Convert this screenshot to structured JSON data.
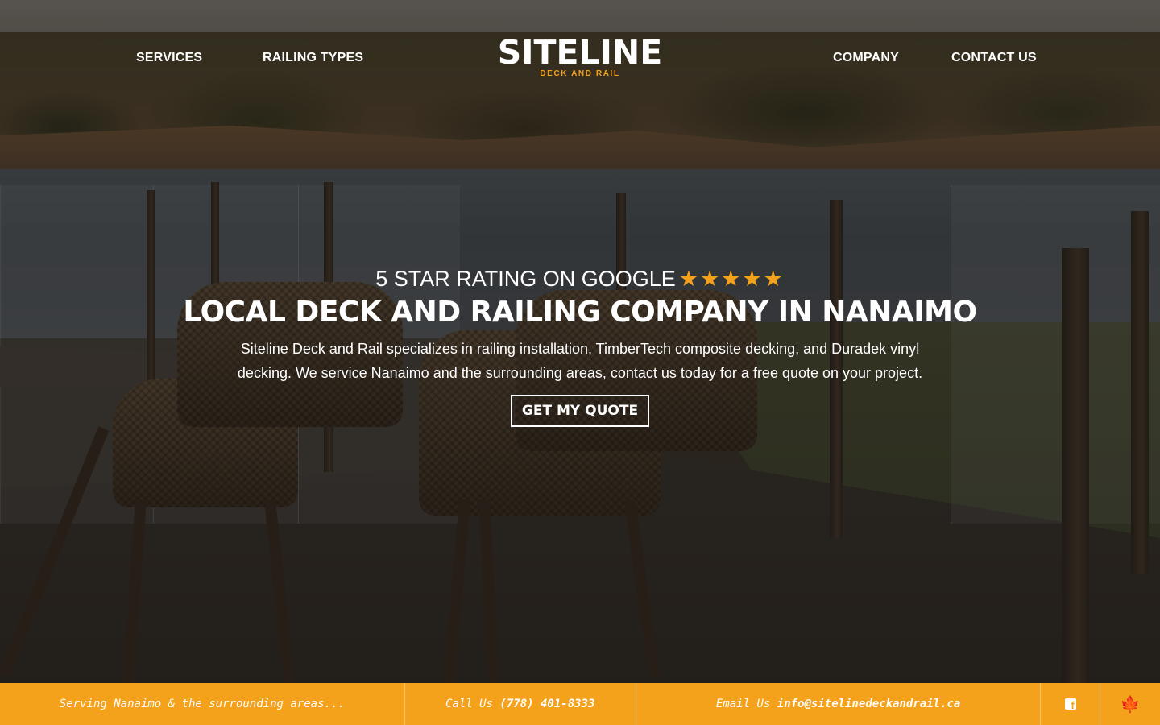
{
  "nav": {
    "left": [
      {
        "label": "SERVICES"
      },
      {
        "label": "RAILING TYPES"
      }
    ],
    "right": [
      {
        "label": "COMPANY"
      },
      {
        "label": "CONTACT US"
      }
    ]
  },
  "logo": {
    "main": "SITELINE",
    "sub": "DECK AND RAIL"
  },
  "hero": {
    "rating_text": "5 STAR RATING ON GOOGLE",
    "stars": "★★★★★",
    "headline": "LOCAL DECK AND RAILING COMPANY IN NANAIMO",
    "description": "Siteline Deck and Rail specializes in railing installation, TimberTech composite decking, and Duradek vinyl decking. We service Nanaimo and the surrounding areas, contact us today for a free quote on your project.",
    "cta_label": "GET MY QUOTE"
  },
  "bar": {
    "serving": "Serving Nanaimo & the surrounding areas...",
    "call_label": "Call Us",
    "phone": "(778) 401-8333",
    "email_label": "Email Us",
    "email": "info@sitelinedeckandrail.ca",
    "facebook_icon": "facebook-icon",
    "maple_leaf_icon": "maple-leaf-icon"
  },
  "colors": {
    "accent": "#f4a21c",
    "text": "#ffffff"
  }
}
